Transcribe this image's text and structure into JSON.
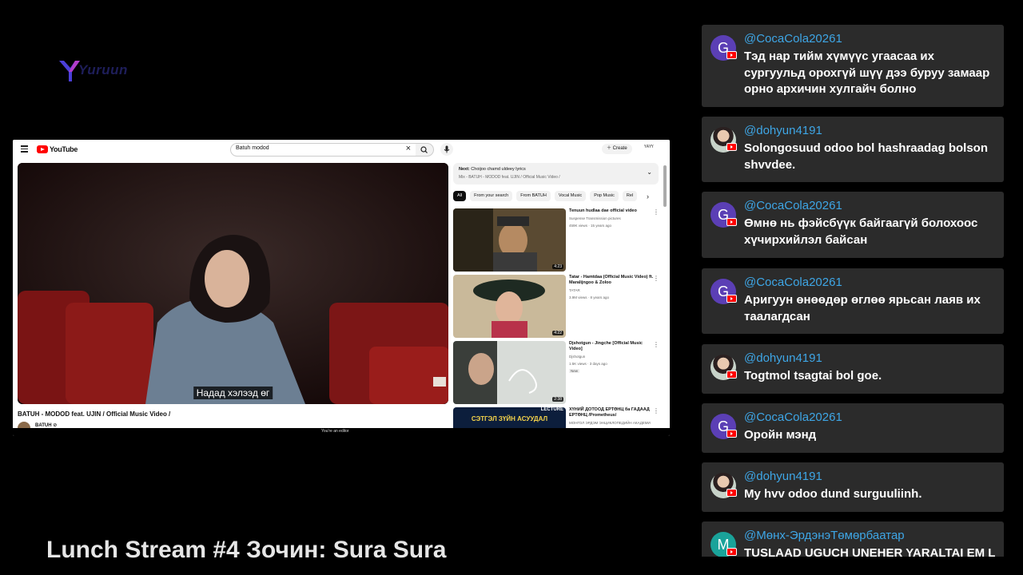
{
  "stream": {
    "logo_text": "Yuruun",
    "title": "Lunch Stream #4 Зочин: Sura Sura"
  },
  "youtube": {
    "logo": "YouTube",
    "search_query": "Batuh modod",
    "create_label": "Create",
    "account_label": "ҮАҮҮ",
    "subtitle": "Надад хэлээд өг",
    "video_title": "BATUH - MODOD feat. UJIN / Official Music Video /",
    "channel_name": "BATUH ⊘",
    "editor_notice": "You're an editor",
    "up_next": {
      "label": "Next:",
      "title": "Choijoo chamd uldeey lyrics",
      "mix": "Mix - BATUH - MODOD feat. UJIN / Official Music Video /"
    },
    "chips": [
      "All",
      "From your search",
      "From BATUH",
      "Vocal Music",
      "Pop Music",
      "Rel"
    ],
    "recommendations": [
      {
        "title": "Tenuun hudlaa dae official video",
        "channel": "Suspense Transmission pictures",
        "meta": "459K views · 15 years ago",
        "duration": "4:23",
        "badge": ""
      },
      {
        "title": "Tatar - Hamtdaa (Official Music Video) ft. Maralijngoo & Zoloo",
        "channel": "TATAR",
        "meta": "3.9M views · 8 years ago",
        "duration": "4:22",
        "badge": ""
      },
      {
        "title": "Djshotgun - Jingche [Official Music Video]",
        "channel": "Djshotgun",
        "meta": "1.5K views · 3 days ago",
        "duration": "2:38",
        "badge": "New"
      },
      {
        "title": "ХҮНИЙ ДОТООД ЕРТӨНЦ ба ГАДААД ЕРТӨНЦ /Prometheus/",
        "channel": "МОНГОЛ ЭРДЭМ ЭНЦИКЛОПЕДИЙН АКАДЕМИ",
        "meta": "",
        "duration": "",
        "badge": "",
        "thumb_text": "СЭТГЭЛ ЗҮЙН АСУУДАЛ",
        "thumb_tag": "LECTURE"
      }
    ]
  },
  "chat": [
    {
      "user": "@CocaCola20261",
      "text": "Тэд нар тийм хүмүүс угаасаа их сургуульд орохгүй шүү дээ буруу замаар орно архичин хулгайч болно",
      "avatar": "G",
      "avatar_style": "g"
    },
    {
      "user": "@dohyun4191",
      "text": "Solongosuud odoo bol hashraadag bolson shvvdee.",
      "avatar": "",
      "avatar_style": "photo"
    },
    {
      "user": "@CocaCola20261",
      "text": "Өмнө нь фэйсбүүк байгаагүй болохоос хүчирхийлэл байсан",
      "avatar": "G",
      "avatar_style": "g"
    },
    {
      "user": "@CocaCola20261",
      "text": "Аригуун өнөөдөр өглөө ярьсан лаяв их таалагдсан",
      "avatar": "G",
      "avatar_style": "g"
    },
    {
      "user": "@dohyun4191",
      "text": "Togtmol tsagtai bol goe.",
      "avatar": "",
      "avatar_style": "photo"
    },
    {
      "user": "@CocaCola20261",
      "text": "Оройн мэнд",
      "avatar": "G",
      "avatar_style": "g"
    },
    {
      "user": "@dohyun4191",
      "text": "My hvv odoo dund surguuliinh.",
      "avatar": "",
      "avatar_style": "photo"
    },
    {
      "user": "@Мөнх-ЭрдэнэТөмөрбаатар",
      "text": "TUSLAAD UGUCH UNEHER YARALTAI EM L",
      "avatar": "M",
      "avatar_style": "m"
    }
  ],
  "colors": {
    "background": "#000000",
    "chat_bubble": "#2b2b2b",
    "username": "#3ea6e6",
    "title": "#e6e6e6",
    "youtube_red": "#ff0000"
  }
}
